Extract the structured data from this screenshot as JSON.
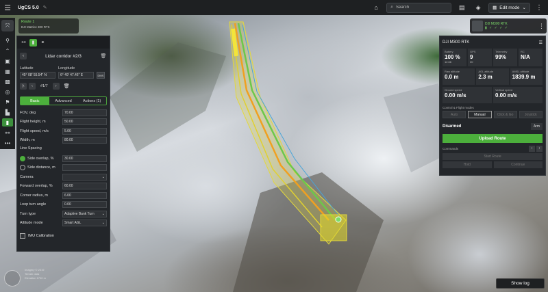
{
  "app": {
    "title": "UgCS 5.0"
  },
  "topbar": {
    "search_placeholder": "Search",
    "mode_label": "Edit mode"
  },
  "route": {
    "name": "Route 1",
    "drone": "DJI Matrice 300 RTK"
  },
  "corridor": {
    "name": "Lidar corridor #2/3",
    "latitude_label": "Latitude",
    "latitude": "45° 08' 55.54\" N",
    "longitude_label": "Longitude",
    "longitude": "6° 49' 47.46\" E",
    "dms": "DMS",
    "waypoint": "#1/7"
  },
  "tabs": [
    "Basic",
    "Advanced",
    "Actions (1)"
  ],
  "fields": {
    "fov": {
      "label": "FOV, deg",
      "value": "70.00"
    },
    "height": {
      "label": "Flight height, m",
      "value": "50.00"
    },
    "speed": {
      "label": "Flight speed, m/s",
      "value": "5.00"
    },
    "width": {
      "label": "Width, m",
      "value": "80.00"
    },
    "line_spacing": "Line Spacing",
    "side_overlap": {
      "label": "Side overlap, %",
      "value": "30.00"
    },
    "side_distance": {
      "label": "Side distance, m",
      "value": ""
    },
    "camera": {
      "label": "Camera",
      "value": ""
    },
    "forward_overlap": {
      "label": "Forward overlap, %",
      "value": "60.00"
    },
    "corner_radius": {
      "label": "Corner radius, m",
      "value": "6.00"
    },
    "loop_turn": {
      "label": "Loop turn angle",
      "value": "0.00"
    },
    "turn_type": {
      "label": "Turn type",
      "value": "Adaptive Bank Turn"
    },
    "altitude_mode": {
      "label": "Altitude mode",
      "value": "Smart AGL"
    },
    "imu": "IMU Calibration"
  },
  "drone_panel": {
    "chip_name": "DJI M300 RTK",
    "title": "DJI M300 RTK",
    "battery": {
      "label": "Battery",
      "value": "100 %",
      "sub": "12.66"
    },
    "gps": {
      "label": "GPS",
      "value": "9",
      "sub": "30"
    },
    "telemetry": {
      "label": "Telemetry",
      "value": "99%"
    },
    "rc": {
      "label": "RC",
      "value": "N/A"
    },
    "raw_alt": {
      "label": "Raw altitude",
      "value": "0.0 m"
    },
    "agl_alt": {
      "label": "AGL altitude",
      "value": "2.3 m"
    },
    "amsl_alt": {
      "label": "AMSL altitude",
      "value": "1839.9 m"
    },
    "ground_speed": {
      "label": "Ground speed",
      "value": "0.00 m/s"
    },
    "vertical_speed": {
      "label": "Vertical speed",
      "value": "0.00 m/s"
    },
    "control_label": "Control & Flight modes",
    "modes": [
      "Auto",
      "Manual",
      "Click & Go",
      "Joystick"
    ],
    "status": "Disarmed",
    "arm": "Arm",
    "upload": "Upload Route",
    "commands_label": "Commands",
    "start_route": "Start Route",
    "hold": "Hold",
    "continue": "Continue"
  },
  "show_log": "Show log",
  "attribution": [
    "Imagery © 2019",
    "Terrain data",
    "Elevation 1700 m"
  ]
}
